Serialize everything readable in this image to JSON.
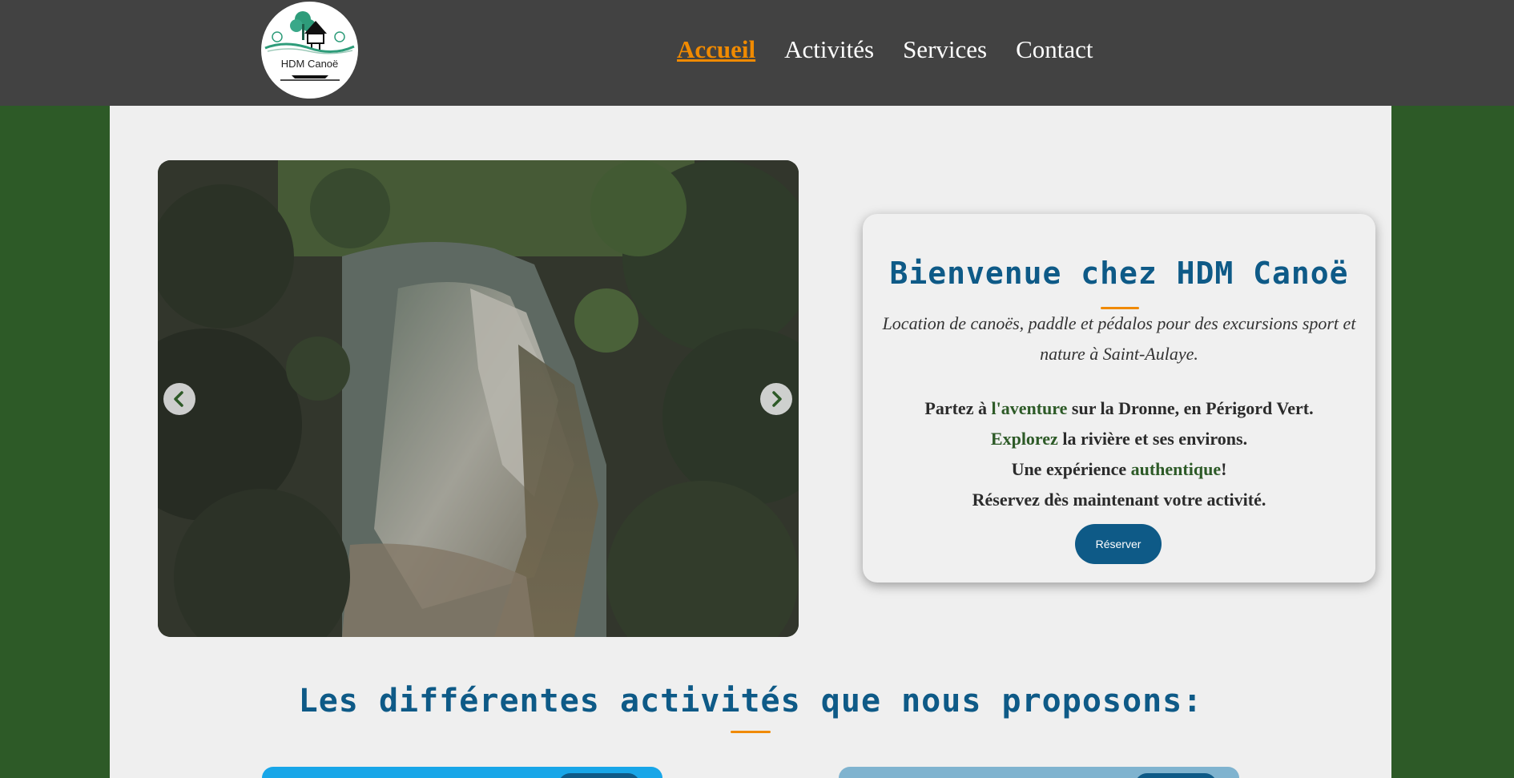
{
  "header": {
    "logo_text": "HDM Canoë",
    "nav": [
      {
        "label": "Accueil",
        "active": true
      },
      {
        "label": "Activités",
        "active": false
      },
      {
        "label": "Services",
        "active": false
      },
      {
        "label": "Contact",
        "active": false
      }
    ]
  },
  "hero": {
    "carousel": {
      "prev_icon": "chevron-left-icon",
      "next_icon": "chevron-right-icon"
    },
    "card": {
      "title": "Bienvenue chez HDM Canoë",
      "lead": "Location de canoës, paddle et pédalos pour des excursions sport et nature à Saint-Aulaye.",
      "line1_a": "Partez à ",
      "line1_hl": "l'aventure",
      "line1_b": " sur la Dronne, en Périgord Vert.",
      "line2_hl": "Explorez",
      "line2_b": " la rivière et ses environs.",
      "line3_a": "Une expérience ",
      "line3_hl": "authentique",
      "line3_b": "!",
      "line4": "Réservez dès maintenant votre activité.",
      "button": "Réserver"
    }
  },
  "activities": {
    "title": "Les différentes activités que nous proposons:"
  },
  "colors": {
    "header_bg": "#424242",
    "page_bg": "#2d5a27",
    "content_bg": "#efefef",
    "accent": "#f08a00",
    "primary": "#0e5a87",
    "highlight": "#2d5a27"
  }
}
